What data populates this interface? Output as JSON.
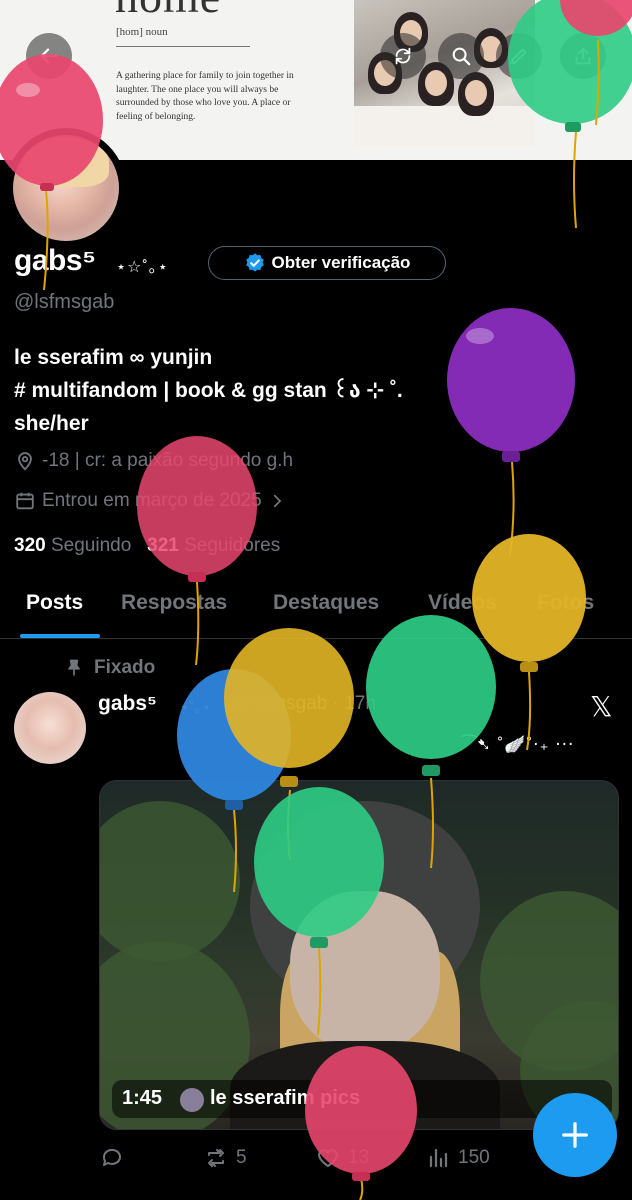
{
  "banner": {
    "word": "home",
    "pronunciation": "[hom] noun",
    "definition": "A gathering place for family to join together in laughter. The one place you will always be surrounded by those who love you. A place or feeling of belonging."
  },
  "header_buttons": [
    "back-arrow-icon",
    "refresh-icon",
    "search-icon",
    "edit-icon",
    "share-icon"
  ],
  "profile": {
    "name": "gabs⁵",
    "name_deco": "⋆☆˚｡⋆",
    "verify_label": "Obter verificação",
    "handle": "@lsfmsgab",
    "bio_line1": "le sserafim ∞ yunjin",
    "bio_line2": "# multifandom | book & gg stan ꒰ა ⊹ ˚.",
    "bio_line3": "she/her",
    "location": "-18 | cr: a paixão segundo g.h",
    "joined": "Entrou em março de 2025",
    "following_count": "320",
    "following_label": "Seguindo",
    "followers_count": "321",
    "followers_label": "Seguidores"
  },
  "tabs": [
    "Posts",
    "Respostas",
    "Destaques",
    "Vídeos",
    "Fotos"
  ],
  "active_tab": "Posts",
  "post": {
    "pinned_label": "Fixado",
    "author": "gabs⁵",
    "author_deco": "⋆˚｡⋆",
    "handle_time": "@lsfmsgab · 17h",
    "text": "⁀➷ ˚🪽˚‧₊ ‧‧‧",
    "duration": "1:45",
    "media_label": "le sserafim pics",
    "reply_count": "",
    "repost_count": "5",
    "like_count": "13",
    "view_count": "150"
  },
  "colors": {
    "accent": "#1d9bf0",
    "muted": "#71767b",
    "balloon_pink": "#e8466e",
    "balloon_purple": "#8e2fc4",
    "balloon_yellow": "#e3b526",
    "balloon_green": "#2ecc85",
    "balloon_blue": "#2e86de"
  }
}
